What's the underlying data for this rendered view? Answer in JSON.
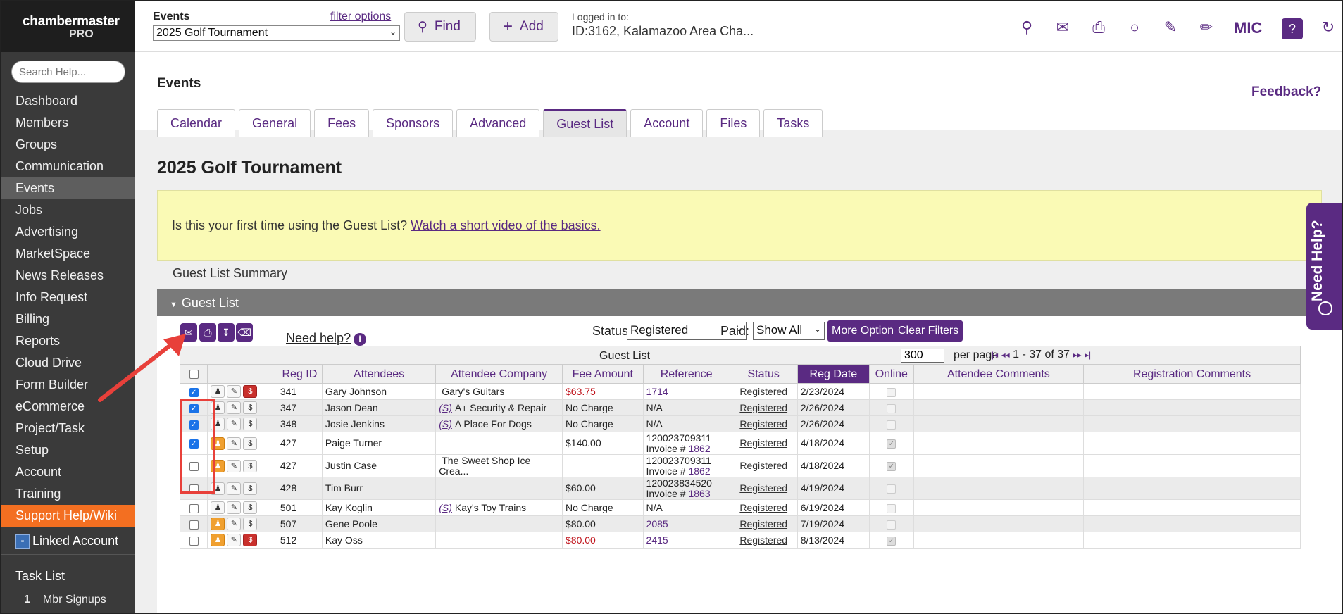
{
  "brand": {
    "line1": "chambermaster",
    "line2": "PRO"
  },
  "sidebar": {
    "search_placeholder": "Search Help...",
    "items": [
      {
        "label": "Dashboard"
      },
      {
        "label": "Members"
      },
      {
        "label": "Groups"
      },
      {
        "label": "Communication"
      },
      {
        "label": "Events"
      },
      {
        "label": "Jobs"
      },
      {
        "label": "Advertising"
      },
      {
        "label": "MarketSpace"
      },
      {
        "label": "News Releases"
      },
      {
        "label": "Info Request"
      },
      {
        "label": "Billing"
      },
      {
        "label": "Reports"
      },
      {
        "label": "Cloud Drive"
      },
      {
        "label": "Form Builder"
      },
      {
        "label": "eCommerce"
      },
      {
        "label": "Project/Task"
      },
      {
        "label": "Setup"
      },
      {
        "label": "Account"
      },
      {
        "label": "Training"
      },
      {
        "label": "Support Help/Wiki"
      }
    ],
    "linked_account": "Linked Account",
    "task_list_title": "Task List",
    "task_item": {
      "count": "1",
      "label": "Mbr Signups"
    }
  },
  "topbar": {
    "events_label": "Events",
    "filter_options": "filter options",
    "event_select": "2025 Golf Tournament",
    "find": "Find",
    "add": "Add",
    "logged_in_label": "Logged in to:",
    "logged_in_value": "ID:3162, Kalamazoo Area Cha...",
    "mic": "MIC",
    "icons": [
      "lightbulb-icon",
      "mail-icon",
      "print-icon",
      "globe-icon",
      "edit-icon",
      "pencil-icon",
      "chat-help-icon",
      "refresh-icon"
    ]
  },
  "main": {
    "heading": "Events",
    "feedback": "Feedback?",
    "tabs": [
      "Calendar",
      "General",
      "Fees",
      "Sponsors",
      "Advanced",
      "Guest List",
      "Account",
      "Files",
      "Tasks"
    ],
    "active_tab": "Guest List",
    "title": "2025 Golf Tournament",
    "banner_text": "Is this your first time using the Guest List?",
    "banner_link": "Watch a short video of the basics.",
    "summary": "Guest List Summary",
    "guest_list_header": "Guest List"
  },
  "toolbar": {
    "need_help": "Need help?",
    "status_label": "Status:",
    "status_value": "Registered",
    "paid_label": "Paid:",
    "paid_value": "Show All",
    "more_options": "More Options",
    "clear_filters": "Clear Filters"
  },
  "table": {
    "caption": "Guest List",
    "per_page_value": "300",
    "per_page_label": "per page",
    "pager": "1 - 37 of 37",
    "columns": [
      "Reg ID",
      "Attendees",
      "Attendee Company",
      "Fee Amount",
      "Reference",
      "Status",
      "Reg Date",
      "Online",
      "Attendee Comments",
      "Registration Comments"
    ],
    "sorted_column": "Reg Date",
    "rows": [
      {
        "reg_id": "341",
        "attendee": "Gary Johnson",
        "company": "Gary's Guitars",
        "s": "",
        "fee": "$63.75",
        "ref": "1714",
        "ref2": "",
        "ref2link": "",
        "status": "Registered",
        "date": "2/23/2024",
        "online": false
      },
      {
        "reg_id": "347",
        "attendee": "Jason Dean",
        "company": "A+ Security & Repair",
        "s": "(S)",
        "fee": "No Charge",
        "ref": "N/A",
        "ref2": "",
        "ref2link": "",
        "status": "Registered",
        "date": "2/26/2024",
        "online": false
      },
      {
        "reg_id": "348",
        "attendee": "Josie Jenkins",
        "company": "A Place For Dogs",
        "s": "(S)",
        "fee": "No Charge",
        "ref": "N/A",
        "ref2": "",
        "ref2link": "",
        "status": "Registered",
        "date": "2/26/2024",
        "online": false
      },
      {
        "reg_id": "427",
        "attendee": "Paige Turner",
        "company": "",
        "s": "",
        "fee": "$140.00",
        "ref": "120023709311",
        "ref2": "Invoice #",
        "ref2link": "1862",
        "status": "Registered",
        "date": "4/18/2024",
        "online": true
      },
      {
        "reg_id": "427",
        "attendee": "Justin Case",
        "company": "The Sweet Shop Ice Crea...",
        "s": "",
        "fee": "",
        "ref": "120023709311",
        "ref2": "Invoice #",
        "ref2link": "1862",
        "status": "Registered",
        "date": "4/18/2024",
        "online": true
      },
      {
        "reg_id": "428",
        "attendee": "Tim Burr",
        "company": "",
        "s": "",
        "fee": "$60.00",
        "ref": "120023834520",
        "ref2": "Invoice #",
        "ref2link": "1863",
        "status": "Registered",
        "date": "4/19/2024",
        "online": false
      },
      {
        "reg_id": "501",
        "attendee": "Kay Koglin",
        "company": "Kay's Toy Trains",
        "s": "(S)",
        "fee": "No Charge",
        "ref": "N/A",
        "ref2": "",
        "ref2link": "",
        "status": "Registered",
        "date": "6/19/2024",
        "online": false
      },
      {
        "reg_id": "507",
        "attendee": "Gene Poole",
        "company": "",
        "s": "",
        "fee": "$80.00",
        "ref": "2085",
        "ref2": "",
        "ref2link": "",
        "status": "Registered",
        "date": "7/19/2024",
        "online": false
      },
      {
        "reg_id": "512",
        "attendee": "Kay Oss",
        "company": "",
        "s": "",
        "fee": "$80.00",
        "ref": "2415",
        "ref2": "",
        "ref2link": "",
        "status": "Registered",
        "date": "8/13/2024",
        "online": true
      }
    ]
  },
  "side_help": "Need Help?"
}
